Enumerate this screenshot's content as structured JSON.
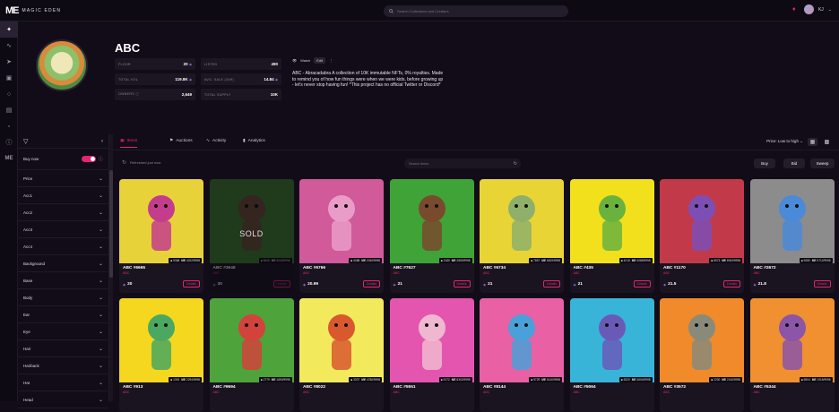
{
  "topbar": {
    "logo_mark": "ME",
    "logo_text": "MAGIC EDEN",
    "search_placeholder": "Search Collections and Creators",
    "username": "KJ",
    "icons": [
      "search-icon",
      "bell-icon",
      "avatar",
      "chevron-down-icon"
    ]
  },
  "sidenav": {
    "icons": [
      "sparkle-icon",
      "activity-icon",
      "launchpad-icon",
      "gamepad-icon",
      "creators-icon",
      "wallet-icon",
      "docs-icon",
      "help-icon",
      "me-icon"
    ]
  },
  "collection": {
    "title": "ABC",
    "stats": {
      "floor_label": "FLOOR",
      "floor_value": "20",
      "listed_label": "LISTED",
      "listed_value": "490",
      "total_vol_label": "TOTAL VOL",
      "total_vol_value": "119.8K",
      "avg_sale_label": "AVG. SALE (24H)",
      "avg_sale_value": "14.84",
      "owners_label": "OWNERS",
      "owners_value": "2,649",
      "supply_label": "TOTAL SUPPLY",
      "supply_value": "10K"
    },
    "watch_label": "Watch",
    "edit_label": "Edit",
    "description": "ABC - Abracadabra A collection of 10K immutable NFTs, 0% royalties. Made to remind you of how fun things were when we were kids, before growing up - let's never stop having fun! *This project has no official Twitter or Discord*"
  },
  "filters": {
    "buy_now_label": "Buy now",
    "items": [
      "Price",
      "Acc1",
      "Acc2",
      "Acc3",
      "Acc4",
      "Background",
      "Base",
      "Body",
      "Ear",
      "Eye",
      "Hair",
      "Hairback",
      "Hat",
      "Head"
    ]
  },
  "tabs": {
    "items": "Items",
    "auctions": "Auctions",
    "activity": "Activity",
    "analytics": "Analytics",
    "sort": "Price: Low to high"
  },
  "toolbar": {
    "refresh_label": "Refreshed just now",
    "search_placeholder": "Search items",
    "buy": "Buy",
    "bid": "Bid",
    "sweep": "Sweep"
  },
  "cards": [
    {
      "name": "ABC #6665",
      "sub": "ABC",
      "rank": "5368",
      "me": "4022/9998",
      "price": "20",
      "details": "Details",
      "sold": false,
      "bg": "#e8d23a",
      "fig": "#c43d8c"
    },
    {
      "name": "ABC #3648",
      "sub": "ABC",
      "rank": "5608",
      "me": "5035/9998",
      "price": "30",
      "details": "Details",
      "sold": true,
      "sold_label": "SOLD",
      "bg": "#3d7a2e",
      "fig": "#6b4a33"
    },
    {
      "name": "ABC #6766",
      "sub": "ABC",
      "rank": "4088",
      "me": "2040/9998",
      "price": "20.99",
      "details": "Details",
      "sold": false,
      "bg": "#d05a9a",
      "fig": "#e99cc8"
    },
    {
      "name": "ABC #7627",
      "sub": "ABC",
      "rank": "2189",
      "me": "2890/9998",
      "price": "21",
      "details": "Details",
      "sold": false,
      "bg": "#3fa338",
      "fig": "#7a4a2c"
    },
    {
      "name": "ABC #6734",
      "sub": "ABC",
      "rank": "7857",
      "me": "6819/9998",
      "price": "21",
      "details": "Details",
      "sold": false,
      "bg": "#e8d535",
      "fig": "#8fb06a"
    },
    {
      "name": "ABC #435",
      "sub": "ABC",
      "rank": "4215",
      "me": "4085/9998",
      "price": "21",
      "details": "Details",
      "sold": false,
      "bg": "#f2e01c",
      "fig": "#6ab23e"
    },
    {
      "name": "ABC #1170",
      "sub": "ABC",
      "rank": "8973",
      "me": "8943/9998",
      "price": "21.5",
      "details": "Details",
      "sold": false,
      "bg": "#c23a4a",
      "fig": "#7d4fb5"
    },
    {
      "name": "ABC #2672",
      "sub": "ABC",
      "rank": "9280",
      "me": "9712/9998",
      "price": "21.8",
      "details": "Details",
      "sold": false,
      "bg": "#8c8c8c",
      "fig": "#4a8ad8"
    },
    {
      "name": "ABC #913",
      "sub": "ABC",
      "rank": "1391",
      "me": "2294/9998",
      "price": "",
      "details": "",
      "sold": false,
      "bg": "#f5d71f",
      "fig": "#4aa860"
    },
    {
      "name": "ABC #9694",
      "sub": "ABC",
      "rank": "2779",
      "me": "1890/9998",
      "price": "",
      "details": "",
      "sold": false,
      "bg": "#4ea33a",
      "fig": "#d2433b"
    },
    {
      "name": "ABC #8022",
      "sub": "ABC",
      "rank": "3337",
      "me": "4786/9998",
      "price": "",
      "details": "",
      "sold": false,
      "bg": "#f2ea5c",
      "fig": "#d9582e"
    },
    {
      "name": "ABC #5551",
      "sub": "ABC",
      "rank": "9172",
      "me": "8302/9998",
      "price": "",
      "details": "",
      "sold": false,
      "bg": "#e455b0",
      "fig": "#f0b8d0"
    },
    {
      "name": "ABC #8144",
      "sub": "ABC",
      "rank": "9729",
      "me": "5140/9998",
      "price": "",
      "details": "",
      "sold": false,
      "bg": "#e960a5",
      "fig": "#4aa0d8"
    },
    {
      "name": "ABC #5064",
      "sub": "ABC",
      "rank": "5320",
      "me": "4604/9998",
      "price": "",
      "details": "",
      "sold": false,
      "bg": "#38b4d8",
      "fig": "#6a5ab8"
    },
    {
      "name": "ABC #3572",
      "sub": "ABC",
      "rank": "2230",
      "me": "2140/9998",
      "price": "",
      "details": "",
      "sold": false,
      "bg": "#f08a2a",
      "fig": "#8a8a7a"
    },
    {
      "name": "ABC #5344",
      "sub": "ABC",
      "rank": "5504",
      "me": "1915/9998",
      "price": "",
      "details": "",
      "sold": false,
      "bg": "#f09030",
      "fig": "#8b55a8"
    }
  ],
  "colors": {
    "accent": "#e42575",
    "bg": "#120c18",
    "card": "#1a1420",
    "sol": "#8d7ae8"
  }
}
